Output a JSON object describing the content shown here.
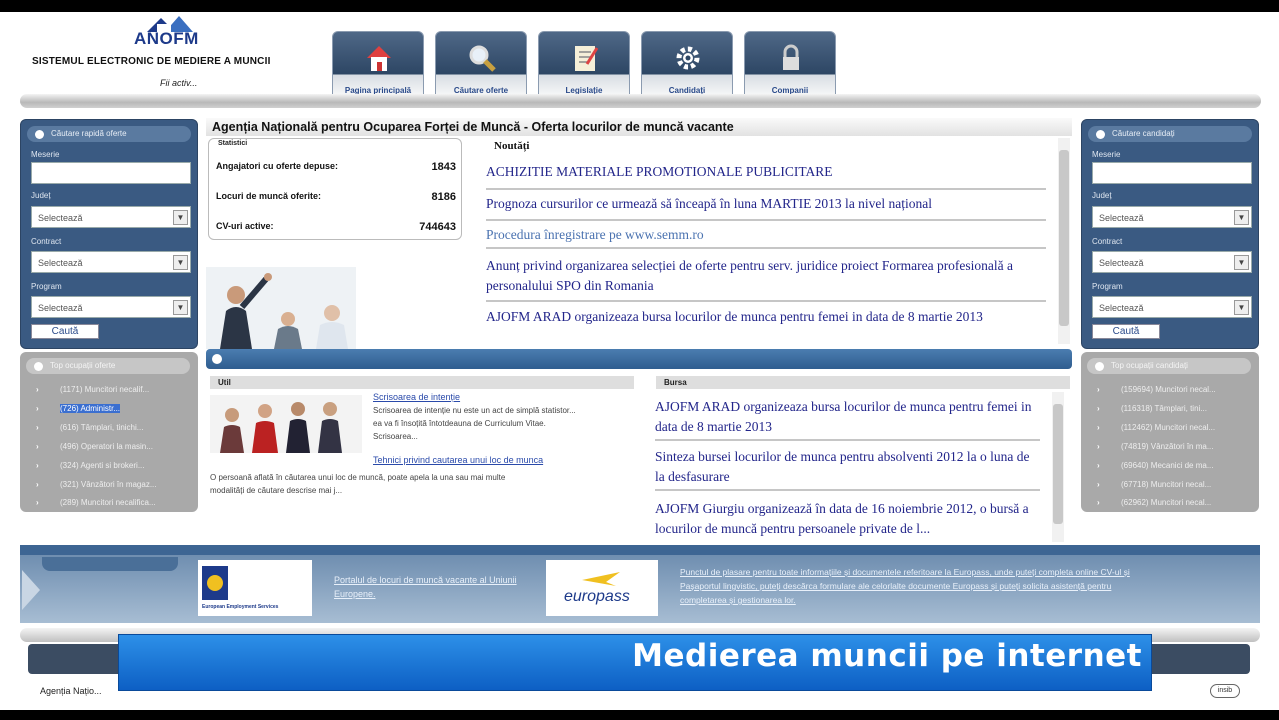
{
  "header": {
    "logo": "ANOFM",
    "title": "SISTEMUL ELECTRONIC DE MEDIERE A MUNCII",
    "tagline": "Fii activ..."
  },
  "nav": [
    {
      "label": "Pagina principală",
      "icon": "home-icon"
    },
    {
      "label": "Căutare oferte",
      "icon": "search-icon"
    },
    {
      "label": "Legislație",
      "icon": "document-icon"
    },
    {
      "label": "Candidați",
      "icon": "gear-icon"
    },
    {
      "label": "Companii",
      "icon": "lock-icon"
    }
  ],
  "left_search": {
    "title": "Căutare rapidă oferte",
    "fields": [
      {
        "label": "Meserie",
        "value": ""
      },
      {
        "label": "Județ",
        "value": "Selectează"
      },
      {
        "label": "Contract",
        "value": "Selectează"
      },
      {
        "label": "Program",
        "value": "Selectează"
      }
    ],
    "button": "Caută"
  },
  "right_search": {
    "title": "Căutare candidați",
    "fields": [
      {
        "label": "Meserie",
        "value": ""
      },
      {
        "label": "Județ",
        "value": "Selectează"
      },
      {
        "label": "Contract",
        "value": "Selectează"
      },
      {
        "label": "Program",
        "value": "Selectează"
      }
    ],
    "button": "Caută"
  },
  "left_top": {
    "title": "Top ocupații oferte",
    "items": [
      "(1171) Muncitori necalif...",
      "(726) Administr...",
      "(616) Tâmplari, tinichi...",
      "(496) Operatori la masin...",
      "(324) Agenti si brokeri...",
      "(321) Vânzători în magaz...",
      "(289) Muncitori necalifica..."
    ]
  },
  "right_top": {
    "title": "Top ocupații candidați",
    "items": [
      "(159694) Muncitori necal...",
      "(116318) Tâmplari, tini...",
      "(112462) Muncitori necal...",
      "(74819) Vânzători în ma...",
      "(69640) Mecanici de ma...",
      "(67718) Muncitori necal...",
      "(62962) Muncitori necal..."
    ]
  },
  "center": {
    "title": "Agenția Națională pentru Ocuparea Forței de Muncă - Oferta locurilor de muncă vacante",
    "stats": {
      "legend": "Statistici",
      "rows": [
        {
          "label": "Angajatori cu oferte depuse:",
          "value": "1843"
        },
        {
          "label": "Locuri de muncă oferite:",
          "value": "8186"
        },
        {
          "label": "CV-uri active:",
          "value": "744643"
        }
      ]
    },
    "news_title": "Noutăți",
    "news": [
      "ACHIZITIE MATERIALE PROMOTIONALE PUBLICITARE",
      "Prognoza cursurilor ce urmează să înceapă în luna MARTIE 2013 la nivel național",
      "Procedura înregistrare pe www.semm.ro",
      "Anunț privind organizarea selecției de oferte pentru serv. juridice proiect Formarea profesională a personalului SPO din Romania",
      "AJOFM ARAD organizeaza bursa locurilor de munca pentru femei in data de 8 martie 2013"
    ],
    "util": {
      "title": "Util",
      "link1": "Scrisoarea de intenție",
      "desc1a": "Scrisoarea de intenție nu este un act de simplă statistor...",
      "desc1b": "ea va fi însoțită întotdeauna de Curriculum Vitae.",
      "desc1c": "Scrisoarea...",
      "link2": "Tehnici privind cautarea unui loc de munca",
      "desc2a": "O persoană aflată în căutarea unui loc de muncă, poate apela la una sau mai multe",
      "desc2b": "modalități de căutare descrise mai j..."
    },
    "bursa": {
      "title": "Bursa",
      "items": [
        "AJOFM ARAD organizeaza bursa locurilor de munca pentru femei in data de 8 martie 2013",
        "Sinteza bursei locurilor de munca pentru absolventi 2012 la o luna de la desfasurare",
        "AJOFM Giurgiu organizează în data de 16 noiembrie 2012, o bursă a locurilor de muncă pentru persoanele private de l..."
      ]
    }
  },
  "footer": {
    "eures_link": "Portalul de locuri de muncă vacante al Uniunii Europene.",
    "eures_caption": "European Employment Services",
    "europass_logo": "europass",
    "europass_link": "Punctul de plasare pentru toate informațiile și documentele referitoare la Europass, unde puteți completa online CV-ul și Pașaportul lingvistic, puteți descărca formulare ale celorlalte documente Europass și puteți solicita asistență pentru completarea și gestionarea lor.",
    "copyright": "Agenția Națio...",
    "small_logo": "insib"
  },
  "caption": "Medierea muncii pe internet",
  "colors": {
    "panel_blue": "#3a5a82",
    "caption_blue": "#1677d9",
    "link": "#22258a"
  }
}
